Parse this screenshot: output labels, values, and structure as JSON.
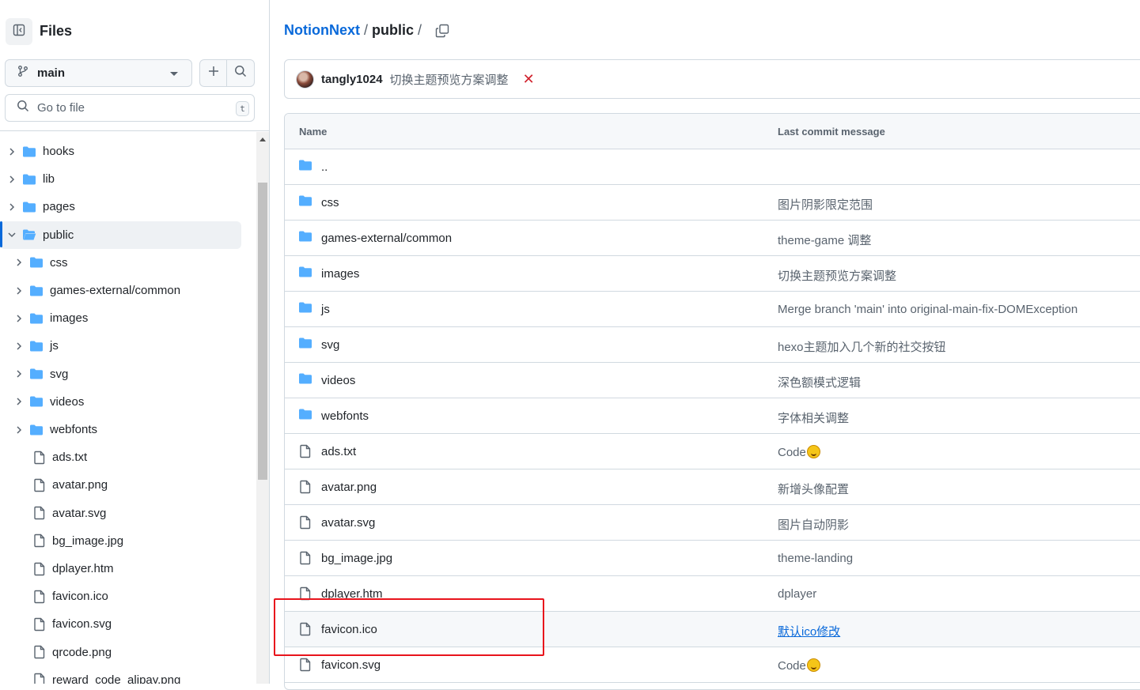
{
  "sidebar": {
    "title": "Files",
    "branch": "main",
    "goto_placeholder": "Go to file",
    "goto_shortcut": "t",
    "tree": [
      {
        "label": "hooks",
        "type": "folder",
        "level": 0,
        "expanded": false
      },
      {
        "label": "lib",
        "type": "folder",
        "level": 0,
        "expanded": false
      },
      {
        "label": "pages",
        "type": "folder",
        "level": 0,
        "expanded": false
      },
      {
        "label": "public",
        "type": "folder",
        "level": 0,
        "expanded": true,
        "selected": true
      },
      {
        "label": "css",
        "type": "folder",
        "level": 1,
        "expanded": false
      },
      {
        "label": "games-external/common",
        "type": "folder",
        "level": 1,
        "expanded": false
      },
      {
        "label": "images",
        "type": "folder",
        "level": 1,
        "expanded": false
      },
      {
        "label": "js",
        "type": "folder",
        "level": 1,
        "expanded": false
      },
      {
        "label": "svg",
        "type": "folder",
        "level": 1,
        "expanded": false
      },
      {
        "label": "videos",
        "type": "folder",
        "level": 1,
        "expanded": false
      },
      {
        "label": "webfonts",
        "type": "folder",
        "level": 1,
        "expanded": false
      },
      {
        "label": "ads.txt",
        "type": "file",
        "level": 1
      },
      {
        "label": "avatar.png",
        "type": "file",
        "level": 1
      },
      {
        "label": "avatar.svg",
        "type": "file",
        "level": 1
      },
      {
        "label": "bg_image.jpg",
        "type": "file",
        "level": 1
      },
      {
        "label": "dplayer.htm",
        "type": "file",
        "level": 1
      },
      {
        "label": "favicon.ico",
        "type": "file",
        "level": 1
      },
      {
        "label": "favicon.svg",
        "type": "file",
        "level": 1
      },
      {
        "label": "qrcode.png",
        "type": "file",
        "level": 1
      },
      {
        "label": "reward_code_alipay.png",
        "type": "file",
        "level": 1
      }
    ]
  },
  "breadcrumb": {
    "repo": "NotionNext",
    "sep1": "/",
    "folder": "public",
    "sep2": "/"
  },
  "commit": {
    "user": "tangly1024",
    "message": "切换主题预览方案调整",
    "status": "✕"
  },
  "table": {
    "col_name": "Name",
    "col_message": "Last commit message",
    "rows": [
      {
        "name": "..",
        "type": "folder",
        "message": ""
      },
      {
        "name": "css",
        "type": "folder",
        "message": "图片阴影限定范围"
      },
      {
        "name": "games-external/common",
        "type": "folder",
        "message": "theme-game 调整"
      },
      {
        "name": "images",
        "type": "folder",
        "message": "切换主题预览方案调整"
      },
      {
        "name": "js",
        "type": "folder",
        "message": "Merge branch 'main' into original-main-fix-DOMException"
      },
      {
        "name": "svg",
        "type": "folder",
        "message": "hexo主题加入几个新的社交按钮"
      },
      {
        "name": "videos",
        "type": "folder",
        "message": "深色额模式逻辑"
      },
      {
        "name": "webfonts",
        "type": "folder",
        "message": "字体相关调整"
      },
      {
        "name": "ads.txt",
        "type": "file",
        "message": "Code",
        "emoji": true
      },
      {
        "name": "avatar.png",
        "type": "file",
        "message": "新增头像配置"
      },
      {
        "name": "avatar.svg",
        "type": "file",
        "message": "图片自动阴影"
      },
      {
        "name": "bg_image.jpg",
        "type": "file",
        "message": "theme-landing"
      },
      {
        "name": "dplayer.htm",
        "type": "file",
        "message": "dplayer"
      },
      {
        "name": "favicon.ico",
        "type": "file",
        "message": "默认ico修改",
        "highlight": true,
        "link": true
      },
      {
        "name": "favicon.svg",
        "type": "file",
        "message": "Code",
        "emoji": true
      }
    ]
  },
  "colors": {
    "accent": "#0969da",
    "folder": "#54aeff",
    "highlight_box": "#e8141c",
    "error": "#d1242f"
  }
}
